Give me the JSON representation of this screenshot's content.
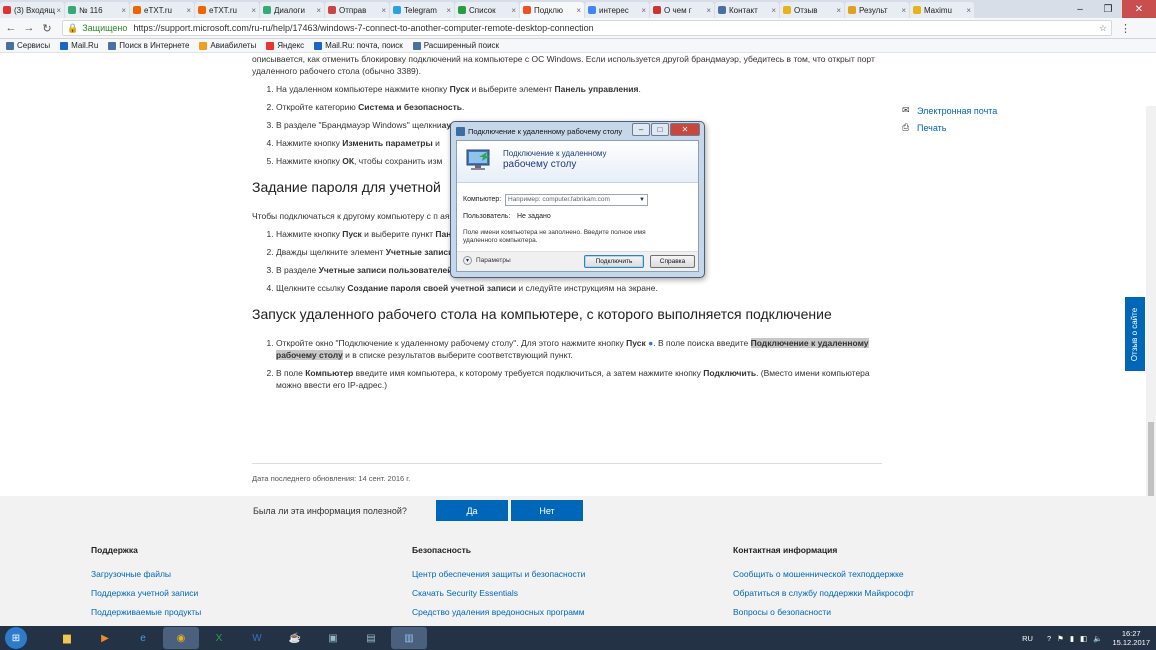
{
  "browser": {
    "tabs": [
      {
        "label": "(3) Входящ",
        "color": "#d33"
      },
      {
        "label": "№ 116",
        "color": "#3a7"
      },
      {
        "label": "eTXT.ru",
        "color": "#e60"
      },
      {
        "label": "eTXT.ru",
        "color": "#e60"
      },
      {
        "label": "Диалоги",
        "color": "#3a7"
      },
      {
        "label": "Отправ",
        "color": "#c44"
      },
      {
        "label": "Telegram",
        "color": "#29a3e0"
      },
      {
        "label": "Список",
        "color": "#2a9d3c"
      },
      {
        "label": "Подклю",
        "color": "#f25022",
        "active": true
      },
      {
        "label": "интерес",
        "color": "#4285f4"
      },
      {
        "label": "О чем г",
        "color": "#c33"
      },
      {
        "label": "Контакт",
        "color": "#4a6fa5"
      },
      {
        "label": "Отзыв",
        "color": "#e8b31a"
      },
      {
        "label": "Результ",
        "color": "#e0a020"
      },
      {
        "label": "Maximu",
        "color": "#e8b31a"
      }
    ],
    "secure_label": "Защищено",
    "url": "https://support.microsoft.com/ru-ru/help/17463/windows-7-connect-to-another-computer-remote-desktop-connection",
    "bookmarks": [
      {
        "label": "Сервисы",
        "color": "#4a6fa5"
      },
      {
        "label": "Mail.Ru",
        "color": "#1a66c4"
      },
      {
        "label": "Поиск в Интернете",
        "color": "#4a6fa5"
      },
      {
        "label": "Авиабилеты",
        "color": "#f0a020"
      },
      {
        "label": "Яндекс",
        "color": "#e33"
      },
      {
        "label": "Mail.Ru: почта, поиск",
        "color": "#1a66c4"
      },
      {
        "label": "Расширенный поиск",
        "color": "#4a6fa5"
      }
    ]
  },
  "article": {
    "intro": "описывается, как отменить блокировку подключений на компьютере с ОС Windows. Если используется другой брандмауэр, убедитесь в том, что открыт порт удаленного рабочего стола (обычно 3389).",
    "list1": [
      {
        "a": "На удаленном компьютере нажмите кнопку ",
        "b": "Пуск",
        "c": " и выберите элемент ",
        "d": "Панель управления",
        "e": "."
      },
      {
        "a": "Откройте категорию ",
        "b": "Система и безопасность",
        "c": ".",
        "d": "",
        "e": ""
      },
      {
        "a": "В разделе \"Брандмауэр Windows\" щелкни",
        "b": "",
        "c": "",
        "d": "ауэр Windows",
        "e": "."
      },
      {
        "a": "Нажмите кнопку ",
        "b": "Изменить параметры",
        "c": " и",
        "d": "",
        "e": ""
      },
      {
        "a": "Нажмите кнопку ",
        "b": "ОК",
        "c": ", чтобы сохранить изм",
        "d": "",
        "e": ""
      }
    ],
    "h2_password": "Задание пароля для учетной",
    "p_password": "Чтобы подключаться к другому компьютеру с п                                                                    ая запись пользователя должна иметь пароль.",
    "list2": [
      {
        "a": "Нажмите кнопку ",
        "b": "Пуск",
        "c": " и выберите пункт ",
        "d": "Панель управления",
        "e": "."
      },
      {
        "a": "Дважды щелкните элемент ",
        "b": "Учетные записи пользователей",
        "c": ".",
        "d": "",
        "e": ""
      },
      {
        "a": "В разделе ",
        "b": "Учетные записи пользователей",
        "c": " выберите пункт ",
        "d": "Изменение пароля Windows",
        "e": "."
      },
      {
        "a": "Щелкните ссылку ",
        "b": "Создание пароля своей учетной записи",
        "c": " и следуйте инструкциям на экране.",
        "d": "",
        "e": ""
      }
    ],
    "h2_launch": "Запуск удаленного рабочего стола на компьютере, с которого выполняется подключение",
    "list3_1": {
      "a": "Откройте окно \"Подключение к удаленному рабочему столу\". Для этого нажмите кнопку ",
      "b": "Пуск",
      "c": ". В поле поиска введите ",
      "d": "Подключение к удаленному рабочему столу",
      "e": " и в списке результатов выберите соответствующий пункт."
    },
    "list3_2": {
      "a": "В поле ",
      "b": "Компьютер",
      "c": " введите имя компьютера, к которому требуется подключиться, а затем нажмите кнопку ",
      "d": "Подключить",
      "e": ". (Вместо имени компьютера можно ввести его IP-адрес.)"
    },
    "updated": "Дата последнего обновления: 14 сент. 2016 г."
  },
  "sidebar": {
    "email": "Электронная почта",
    "print": "Печать"
  },
  "feedback_tab": "Отзыв о сайте",
  "feedback": {
    "question": "Была ли эта информация полезной?",
    "yes": "Да",
    "no": "Нет"
  },
  "footer": [
    {
      "heading": "Поддержка",
      "links": [
        "Загрузочные файлы",
        "Поддержка учетной записи",
        "Поддерживаемые продукты"
      ]
    },
    {
      "heading": "Безопасность",
      "links": [
        "Центр обеспечения защиты и безопасности",
        "Скачать Security Essentials",
        "Средство удаления вредоносных программ"
      ]
    },
    {
      "heading": "Контактная информация",
      "links": [
        "Сообщить о мошеннической техподдержке",
        "Обратиться в службу поддержки Майкрософт",
        "Вопросы о безопасности"
      ]
    }
  ],
  "dialog": {
    "title": "Подключение к удаленному рабочему столу",
    "header_line1": "Подключение к удаленному",
    "header_line2": "рабочему столу",
    "computer_label": "Компьютер:",
    "computer_placeholder": "Например: computer.fabrikam.com",
    "user_label": "Пользователь:",
    "user_value": "Не задано",
    "note": "Поле имени компьютера не заполнено. Введите полное имя удаленного компьютера.",
    "params": "Параметры",
    "connect": "Подключить",
    "help": "Справка"
  },
  "taskbar": {
    "lang": "RU",
    "time": "16:27",
    "date": "15.12.2017"
  }
}
